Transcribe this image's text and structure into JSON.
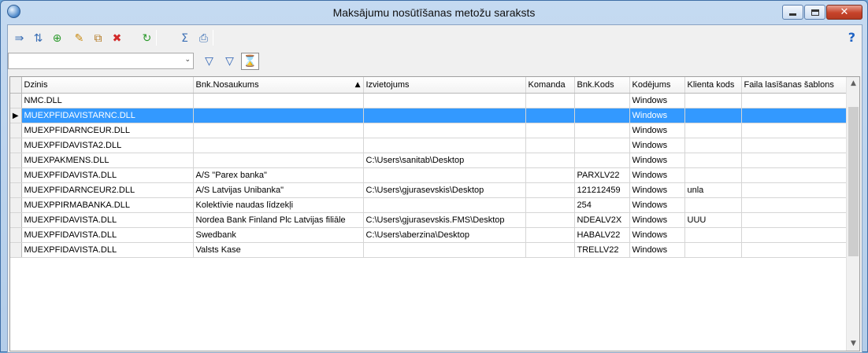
{
  "window": {
    "title": "Maksājumu nosūtīšanas metožu saraksts"
  },
  "toolbar": {
    "buttons": [
      {
        "icon": "export-icon",
        "glyph": "⇛",
        "color": "#3b6fb5"
      },
      {
        "icon": "sort-icon",
        "glyph": "⇅",
        "color": "#3b6fb5"
      },
      {
        "icon": "new-record-icon",
        "glyph": "⊕",
        "color": "#2c9a2c"
      },
      {
        "icon": "edit-icon",
        "glyph": "✎",
        "color": "#c98a12"
      },
      {
        "icon": "copy-icon",
        "glyph": "⧉",
        "color": "#b0741a"
      },
      {
        "icon": "delete-icon",
        "glyph": "✖",
        "color": "#d22a2a"
      },
      {
        "icon": "refresh-icon",
        "glyph": "↻",
        "color": "#2c9a2c"
      },
      {
        "icon": "sum-icon",
        "glyph": "Σ",
        "color": "#3b6fb5"
      },
      {
        "icon": "print-icon",
        "glyph": "⎙",
        "color": "#3b6fb5"
      }
    ],
    "help_glyph": "?"
  },
  "filter": {
    "combo_value": "",
    "combo_arrow": "⌄",
    "filter_glyph": "▽",
    "filter2_glyph": "▽",
    "clear_filter_glyph": "⌛"
  },
  "table": {
    "columns": [
      "Dzinis",
      "Bnk.Nosaukums",
      "Izvietojums",
      "Komanda",
      "Bnk.Kods",
      "Kodējums",
      "Klienta kods",
      "Faila lasīšanas šablons"
    ],
    "sort_indicator": "▲",
    "row_pointer": "▶",
    "selected_index": 1,
    "rows": [
      [
        "NMC.DLL",
        "",
        "",
        "",
        "",
        "Windows",
        "",
        ""
      ],
      [
        "MUEXPFIDAVISTARNC.DLL",
        "",
        "",
        "",
        "",
        "Windows",
        "",
        ""
      ],
      [
        "MUEXPFIDARNCEUR.DLL",
        "",
        "",
        "",
        "",
        "Windows",
        "",
        ""
      ],
      [
        "MUEXPFIDAVISTA2.DLL",
        "",
        "",
        "",
        "",
        "Windows",
        "",
        ""
      ],
      [
        "MUEXPAKMENS.DLL",
        "",
        "C:\\Users\\sanitab\\Desktop",
        "",
        "",
        "Windows",
        "",
        ""
      ],
      [
        "MUEXPFIDAVISTA.DLL",
        "A/S \"Parex banka\"",
        "",
        "",
        "PARXLV22",
        "Windows",
        "",
        ""
      ],
      [
        "MUEXPFIDARNCEUR2.DLL",
        "A/S Latvijas Unibanka\"",
        "C:\\Users\\gjurasevskis\\Desktop",
        "",
        "121212459",
        "Windows",
        "unla",
        ""
      ],
      [
        "MUEXPPIRMABANKA.DLL",
        "Kolektīvie naudas līdzekļi",
        "",
        "",
        "254",
        "Windows",
        "",
        ""
      ],
      [
        "MUEXPFIDAVISTA.DLL",
        "Nordea Bank Finland Plc Latvijas filiāle",
        "C:\\Users\\gjurasevskis.FMS\\Desktop",
        "",
        "NDEALV2X",
        "Windows",
        "UUU",
        ""
      ],
      [
        "MUEXPFIDAVISTA.DLL",
        "Swedbank",
        "C:\\Users\\aberzina\\Desktop",
        "",
        "HABALV22",
        "Windows",
        "",
        ""
      ],
      [
        "MUEXPFIDAVISTA.DLL",
        "Valsts Kase",
        "",
        "",
        "TRELLV22",
        "Windows",
        "",
        ""
      ]
    ]
  },
  "scrollbar": {
    "up_glyph": "▲",
    "down_glyph": "▼"
  }
}
